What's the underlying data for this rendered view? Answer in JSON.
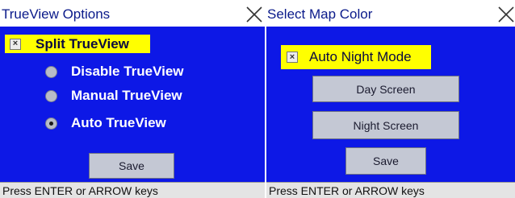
{
  "left": {
    "title": "TrueView Options",
    "checkbox": {
      "label": "Split TrueView",
      "mark": "×"
    },
    "radios": [
      {
        "label": "Disable TrueView",
        "selected": false
      },
      {
        "label": "Manual TrueView",
        "selected": false
      },
      {
        "label": "Auto TrueView",
        "selected": true
      }
    ],
    "save_label": "Save",
    "status": "Press ENTER or ARROW keys"
  },
  "right": {
    "title": "Select Map Color",
    "checkbox": {
      "label": "Auto Night Mode",
      "mark": "×"
    },
    "buttons": {
      "day": "Day Screen",
      "night": "Night Screen",
      "save": "Save"
    },
    "status": "Press ENTER or ARROW keys"
  },
  "icons": {
    "close": "close-icon"
  },
  "colors": {
    "content_bg": "#0d18e6",
    "checkbox_highlight": "#ffff00",
    "title_text": "#0a1a8a"
  }
}
